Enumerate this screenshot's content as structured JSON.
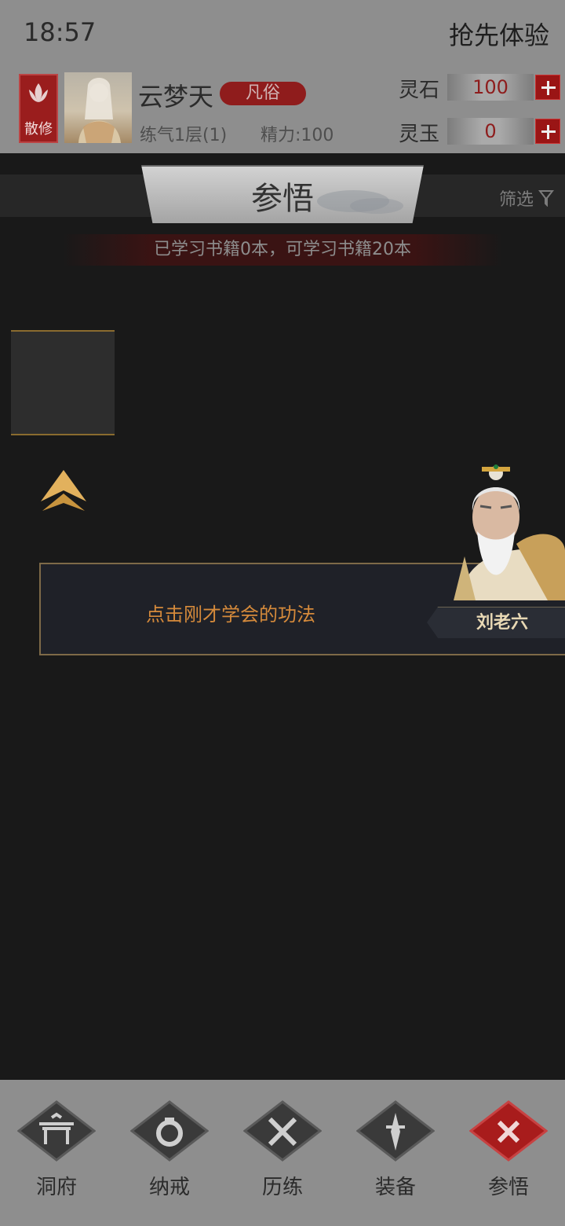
{
  "status_bar": {
    "time": "18:57",
    "action": "抢先体验"
  },
  "player": {
    "sect_badge": "散修",
    "name": "云梦天",
    "realm": "凡俗",
    "level": "练气1层(1)",
    "energy": "精力:100"
  },
  "resources": [
    {
      "label": "灵石",
      "value": "100"
    },
    {
      "label": "灵玉",
      "value": "0"
    }
  ],
  "tab": {
    "title": "参悟",
    "filter_label": "筛选"
  },
  "info_text": "已学习书籍0本，可学习书籍20本",
  "dialog": {
    "text": "点击刚才学会的功法",
    "npc_name": "刘老六"
  },
  "nav": [
    {
      "label": "洞府",
      "icon": "gate-icon"
    },
    {
      "label": "纳戒",
      "icon": "ring-icon"
    },
    {
      "label": "历练",
      "icon": "crossed-swords-icon"
    },
    {
      "label": "装备",
      "icon": "dagger-icon"
    },
    {
      "label": "参悟",
      "icon": "close-icon",
      "active": true
    }
  ],
  "colors": {
    "accent_red": "#9a1515",
    "gold": "#d9a54c",
    "dialog_text": "#d58a3b"
  }
}
